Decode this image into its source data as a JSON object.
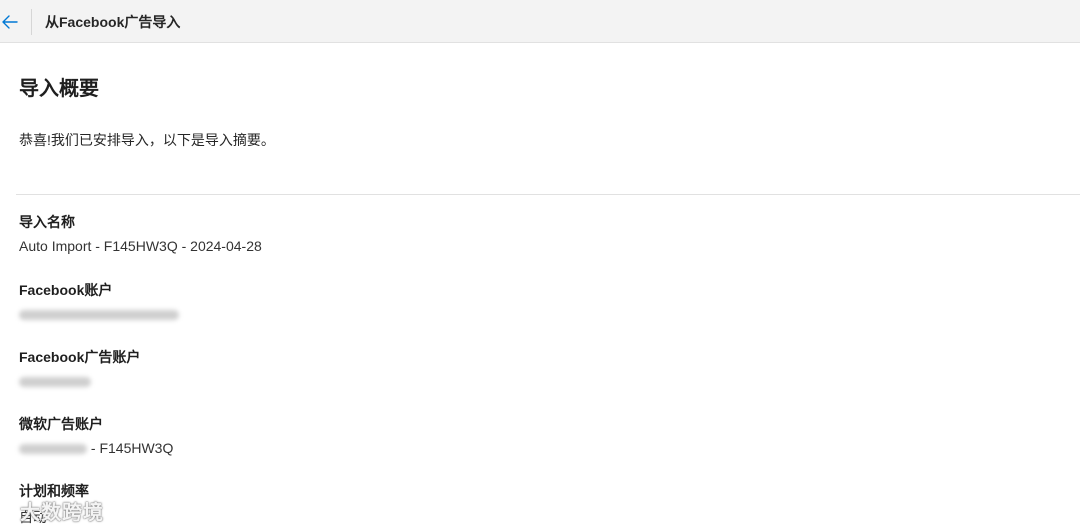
{
  "header": {
    "title": "从Facebook广告导入",
    "back_icon": "arrow-left-icon",
    "accent_color": "#0078d4"
  },
  "summary": {
    "title": "导入概要",
    "intro": "恭喜!我们已安排导入，以下是导入摘要。"
  },
  "fields": {
    "import_name": {
      "label": "导入名称",
      "value": "Auto Import - F145HW3Q - 2024-04-28"
    },
    "facebook_account": {
      "label": "Facebook账户",
      "value": ""
    },
    "facebook_ad_account": {
      "label": "Facebook广告账户",
      "value": ""
    },
    "microsoft_ad_account": {
      "label": "微软广告账户",
      "value_suffix": "- F145HW3Q"
    },
    "schedule": {
      "label": "计划和频率",
      "value": "自动"
    }
  },
  "watermark": {
    "text": "大数跨境"
  }
}
